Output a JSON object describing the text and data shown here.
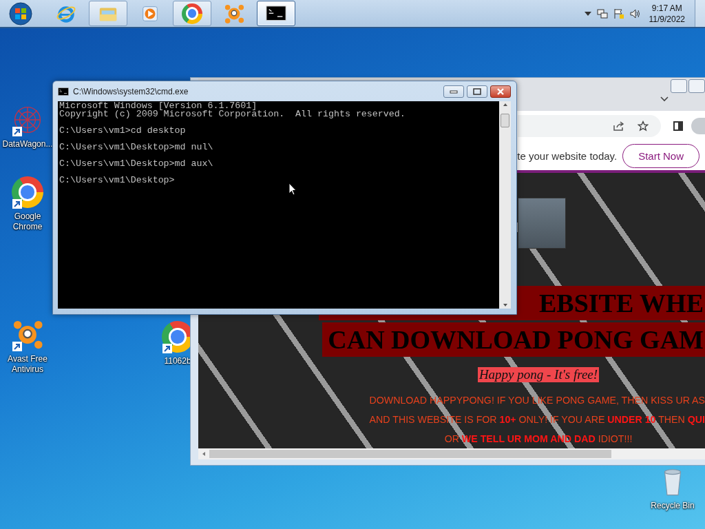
{
  "taskbar": {
    "items": [
      {
        "kind": "start",
        "running": false,
        "selected": false
      },
      {
        "kind": "ie",
        "running": false,
        "selected": false
      },
      {
        "kind": "explorer",
        "running": true,
        "selected": false
      },
      {
        "kind": "media",
        "running": false,
        "selected": false
      },
      {
        "kind": "chrome",
        "running": true,
        "selected": false
      },
      {
        "kind": "avast",
        "running": false,
        "selected": false
      },
      {
        "kind": "cmd",
        "running": true,
        "selected": true
      }
    ],
    "tray": {
      "time": "9:17 AM",
      "date": "11/9/2022"
    }
  },
  "desktop_icons": [
    {
      "kind": "datawagon",
      "label": "DataWagon..."
    },
    {
      "kind": "chrome",
      "label": "Google Chrome"
    },
    {
      "kind": "avast",
      "label": "Avast Free Antivirus"
    },
    {
      "kind": "chrome",
      "label": "11062b"
    },
    {
      "kind": "recycle",
      "label": "Recycle Bin"
    }
  ],
  "browser": {
    "banner_text": "te your website today.",
    "banner_button": "Start Now",
    "page": {
      "headline": [
        "EBSITE WHE",
        "CAN DOWNLOAD PONG GAM"
      ],
      "tagline": "Happy pong - It's free!",
      "paragraph": [
        {
          "kind": "cut",
          "text": "DOWNLOAD HAPPYPONG! IF YOU LIKE PONG GAME, THEN KISS UR AS"
        },
        {
          "kind": "cut",
          "text": "AND THIS WEBSITE IS FOR **10+** ONLY! IF YOU ARE **UNDER 10** THEN **QUI**"
        },
        {
          "kind": "full",
          "text": "OR **WE TELL UR MOM AND DAD** IDIOT!!!"
        }
      ]
    }
  },
  "console_window": {
    "title": "C:\\Windows\\system32\\cmd.exe",
    "blocks": [
      [
        "Microsoft Windows [Version 6.1.7601]",
        "Copyright (c) 2009 Microsoft Corporation.  All rights reserved."
      ],
      [
        "C:\\Users\\vm1>cd desktop"
      ],
      [
        "C:\\Users\\vm1\\Desktop>md nul\\"
      ],
      [
        "C:\\Users\\vm1\\Desktop>md aux\\"
      ],
      [
        "C:\\Users\\vm1\\Desktop>"
      ]
    ]
  }
}
